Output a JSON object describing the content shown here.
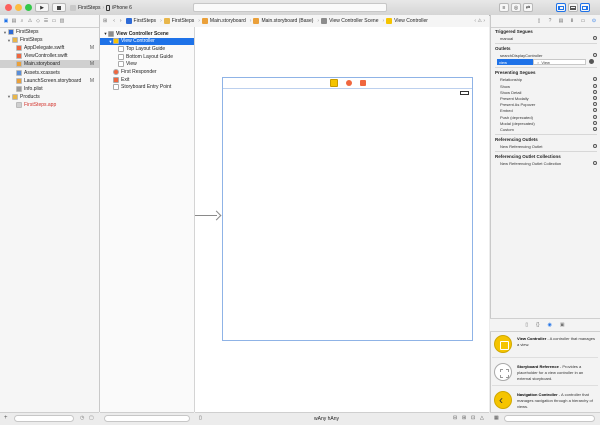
{
  "toolbar": {
    "scheme_target": "FirstSteps",
    "scheme_device": "iPhone 6"
  },
  "colors": {
    "accent": "#1e72e8",
    "close": "#fc605c",
    "minimize": "#fdbc40",
    "zoom": "#34c84a",
    "folder": "#e8b64a",
    "swift": "#f0673f",
    "storyboard": "#eaa03a",
    "yellow": "#f5c400",
    "red_text": "#d3312a"
  },
  "jumpbar": {
    "crumbs": [
      "FirstSteps",
      "FirstSteps",
      "Main.storyboard",
      "Main.storyboard (Base)",
      "View Controller Scene",
      "View Controller"
    ]
  },
  "navigator": {
    "items": [
      {
        "label": "FirstSteps",
        "indent": 0,
        "disclosure": "▼",
        "kind": "project",
        "status": ""
      },
      {
        "label": "FirstSteps",
        "indent": 1,
        "disclosure": "▼",
        "kind": "folder",
        "status": ""
      },
      {
        "label": "AppDelegate.swift",
        "indent": 2,
        "disclosure": "",
        "kind": "swift",
        "status": "M"
      },
      {
        "label": "ViewController.swift",
        "indent": 2,
        "disclosure": "",
        "kind": "swift",
        "status": ""
      },
      {
        "label": "Main.storyboard",
        "indent": 2,
        "disclosure": "",
        "kind": "storyboard",
        "status": "M",
        "selected": true
      },
      {
        "label": "Assets.xcassets",
        "indent": 2,
        "disclosure": "",
        "kind": "assets",
        "status": ""
      },
      {
        "label": "LaunchScreen.storyboard",
        "indent": 2,
        "disclosure": "",
        "kind": "storyboard",
        "status": "M"
      },
      {
        "label": "Info.plist",
        "indent": 2,
        "disclosure": "",
        "kind": "plist",
        "status": ""
      },
      {
        "label": "Products",
        "indent": 1,
        "disclosure": "▼",
        "kind": "folder",
        "status": ""
      },
      {
        "label": "FirstSteps.app",
        "indent": 2,
        "disclosure": "",
        "kind": "app",
        "status": "",
        "red": true
      }
    ]
  },
  "outline": {
    "items": [
      {
        "label": "View Controller Scene",
        "indent": 0,
        "disclosure": "▼",
        "kind": "scene",
        "bold": true
      },
      {
        "label": "View Controller",
        "indent": 1,
        "disclosure": "▼",
        "kind": "vc",
        "selected": true
      },
      {
        "label": "Top Layout Guide",
        "indent": 2,
        "disclosure": "",
        "kind": "guide"
      },
      {
        "label": "Bottom Layout Guide",
        "indent": 2,
        "disclosure": "",
        "kind": "guide"
      },
      {
        "label": "View",
        "indent": 2,
        "disclosure": "",
        "kind": "guide"
      },
      {
        "label": "First Responder",
        "indent": 1,
        "disclosure": "",
        "kind": "responder"
      },
      {
        "label": "Exit",
        "indent": 1,
        "disclosure": "",
        "kind": "exit"
      },
      {
        "label": "Storyboard Entry Point",
        "indent": 1,
        "disclosure": "",
        "kind": "entry"
      }
    ]
  },
  "canvas": {
    "size_class": "wAny hAny"
  },
  "inspector": {
    "triggered_segues": {
      "title": "Triggered Segues",
      "items": [
        "manual"
      ]
    },
    "outlets": {
      "title": "Outlets",
      "items": [
        {
          "name": "searchDisplayController",
          "value": ""
        },
        {
          "name": "view",
          "value": "View"
        }
      ]
    },
    "presenting_segues": {
      "title": "Presenting Segues",
      "items": [
        "Relationship",
        "Show",
        "Show Detail",
        "Present Modally",
        "Present As Popover",
        "Embed",
        "Push (deprecated)",
        "Modal (deprecated)",
        "Custom"
      ]
    },
    "referencing_outlets": {
      "title": "Referencing Outlets",
      "items": [
        "New Referencing Outlet"
      ]
    },
    "referencing_outlet_collections": {
      "title": "Referencing Outlet Collections",
      "items": [
        "New Referencing Outlet Collection"
      ]
    }
  },
  "library": {
    "items": [
      {
        "title": "View Controller",
        "desc": " - A controller that manages a view.",
        "color": "#f5c400"
      },
      {
        "title": "Storyboard Reference",
        "desc": " - Provides a placeholder for a view controller in an external storyboard.",
        "color": "#ffffff"
      },
      {
        "title": "Navigation Controller",
        "desc": " - A controller that manages navigation through a hierarchy of views.",
        "color": "#f5c400"
      }
    ]
  }
}
